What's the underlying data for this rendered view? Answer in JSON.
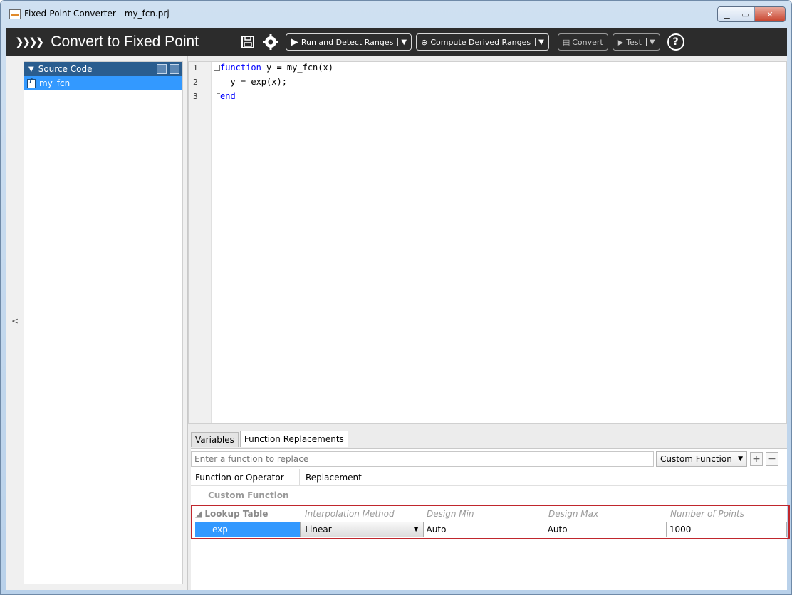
{
  "window": {
    "title": "Fixed-Point Converter - my_fcn.prj"
  },
  "toolbar": {
    "title": "Convert to Fixed Point",
    "run_label": "Run and Detect Ranges",
    "compute_label": "Compute Derived Ranges",
    "convert_label": "Convert",
    "test_label": "Test",
    "help_label": "?"
  },
  "source_panel": {
    "header": "Source Code",
    "items": [
      {
        "label": "my_fcn",
        "selected": true
      }
    ]
  },
  "editor": {
    "lines": [
      {
        "number": "1",
        "keyword": "function",
        "rest": " y = my_fcn(x)",
        "end_keyword": ""
      },
      {
        "number": "2",
        "keyword": "",
        "rest": "  y = exp(x);",
        "end_keyword": ""
      },
      {
        "number": "3",
        "keyword": "end",
        "rest": "",
        "end_keyword": ""
      }
    ]
  },
  "bottom_panel": {
    "tabs": [
      {
        "label": "Variables",
        "active": false
      },
      {
        "label": "Function Replacements",
        "active": true
      }
    ],
    "search_placeholder": "Enter a function to replace",
    "replacement_type": "Custom Function",
    "add_label": "+",
    "remove_label": "−",
    "columns": {
      "function_or_operator": "Function or Operator",
      "replacement": "Replacement"
    },
    "custom_function_label": "Custom Function",
    "lookup_table": {
      "label": "Lookup Table",
      "headers": [
        "Interpolation Method",
        "Design Min",
        "Design Max",
        "Number of Points"
      ],
      "row": {
        "function": "exp",
        "interpolation": "Linear",
        "design_min": "Auto",
        "design_max": "Auto",
        "points": "1000"
      }
    }
  },
  "colors": {
    "toolbar_bg": "#2c2c2c",
    "header_blue": "#2a5d8f",
    "selection_blue": "#3399ff",
    "highlight_red": "#c0272d",
    "keyword_blue": "#0000ff"
  }
}
